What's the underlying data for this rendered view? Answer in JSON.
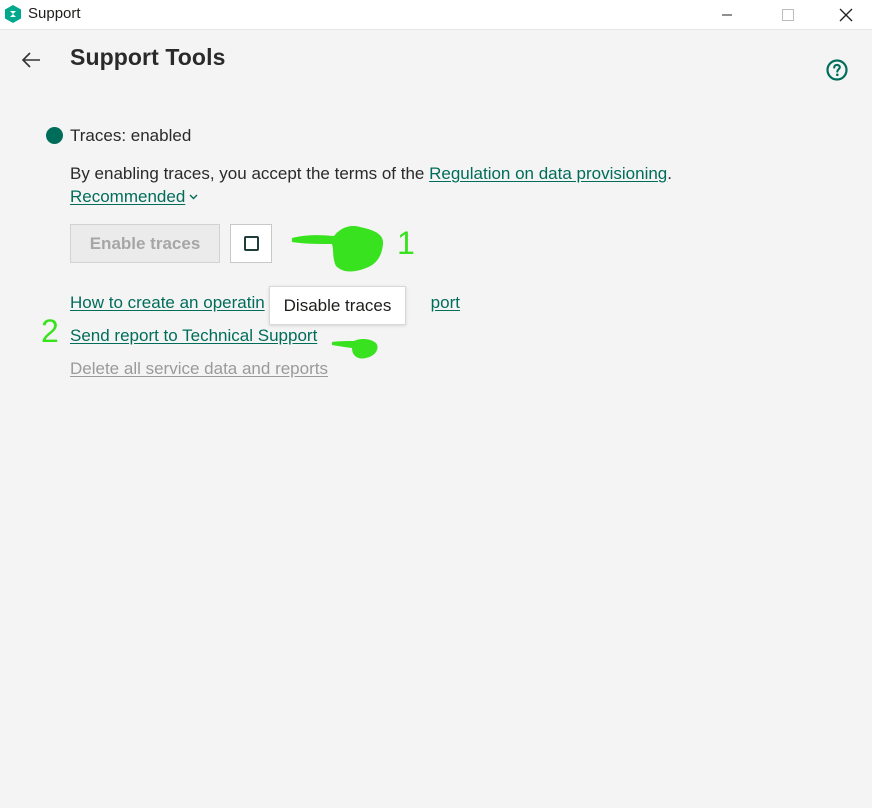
{
  "window": {
    "title": "Support",
    "controls": [
      "minimize",
      "maximize",
      "close"
    ]
  },
  "header": {
    "title": "Support Tools",
    "back_icon": "arrow-left-icon",
    "help_icon": "question-circle-icon"
  },
  "traces": {
    "status_label": "Traces: enabled",
    "status_color": "#006d5b",
    "terms_prefix": "By enabling traces, you accept the terms of the ",
    "terms_link": "Regulation on data provisioning",
    "terms_suffix": ".",
    "recommended_label": "Recommended",
    "enable_button_label": "Enable traces",
    "disable_button_icon": "stop-square-icon",
    "disable_tooltip": "Disable traces"
  },
  "links": {
    "dump_prefix": "How to create an operatin",
    "dump_suffix": "port",
    "send_report": "Send report to Technical Support",
    "delete_all": "Delete all service data and reports"
  },
  "annotations": {
    "marker_1": "1",
    "marker_2": "2",
    "color": "#39e21e"
  },
  "colors": {
    "accent": "#006d5b",
    "background": "#f4f4f4",
    "disabled_text": "#a6a6a6"
  }
}
